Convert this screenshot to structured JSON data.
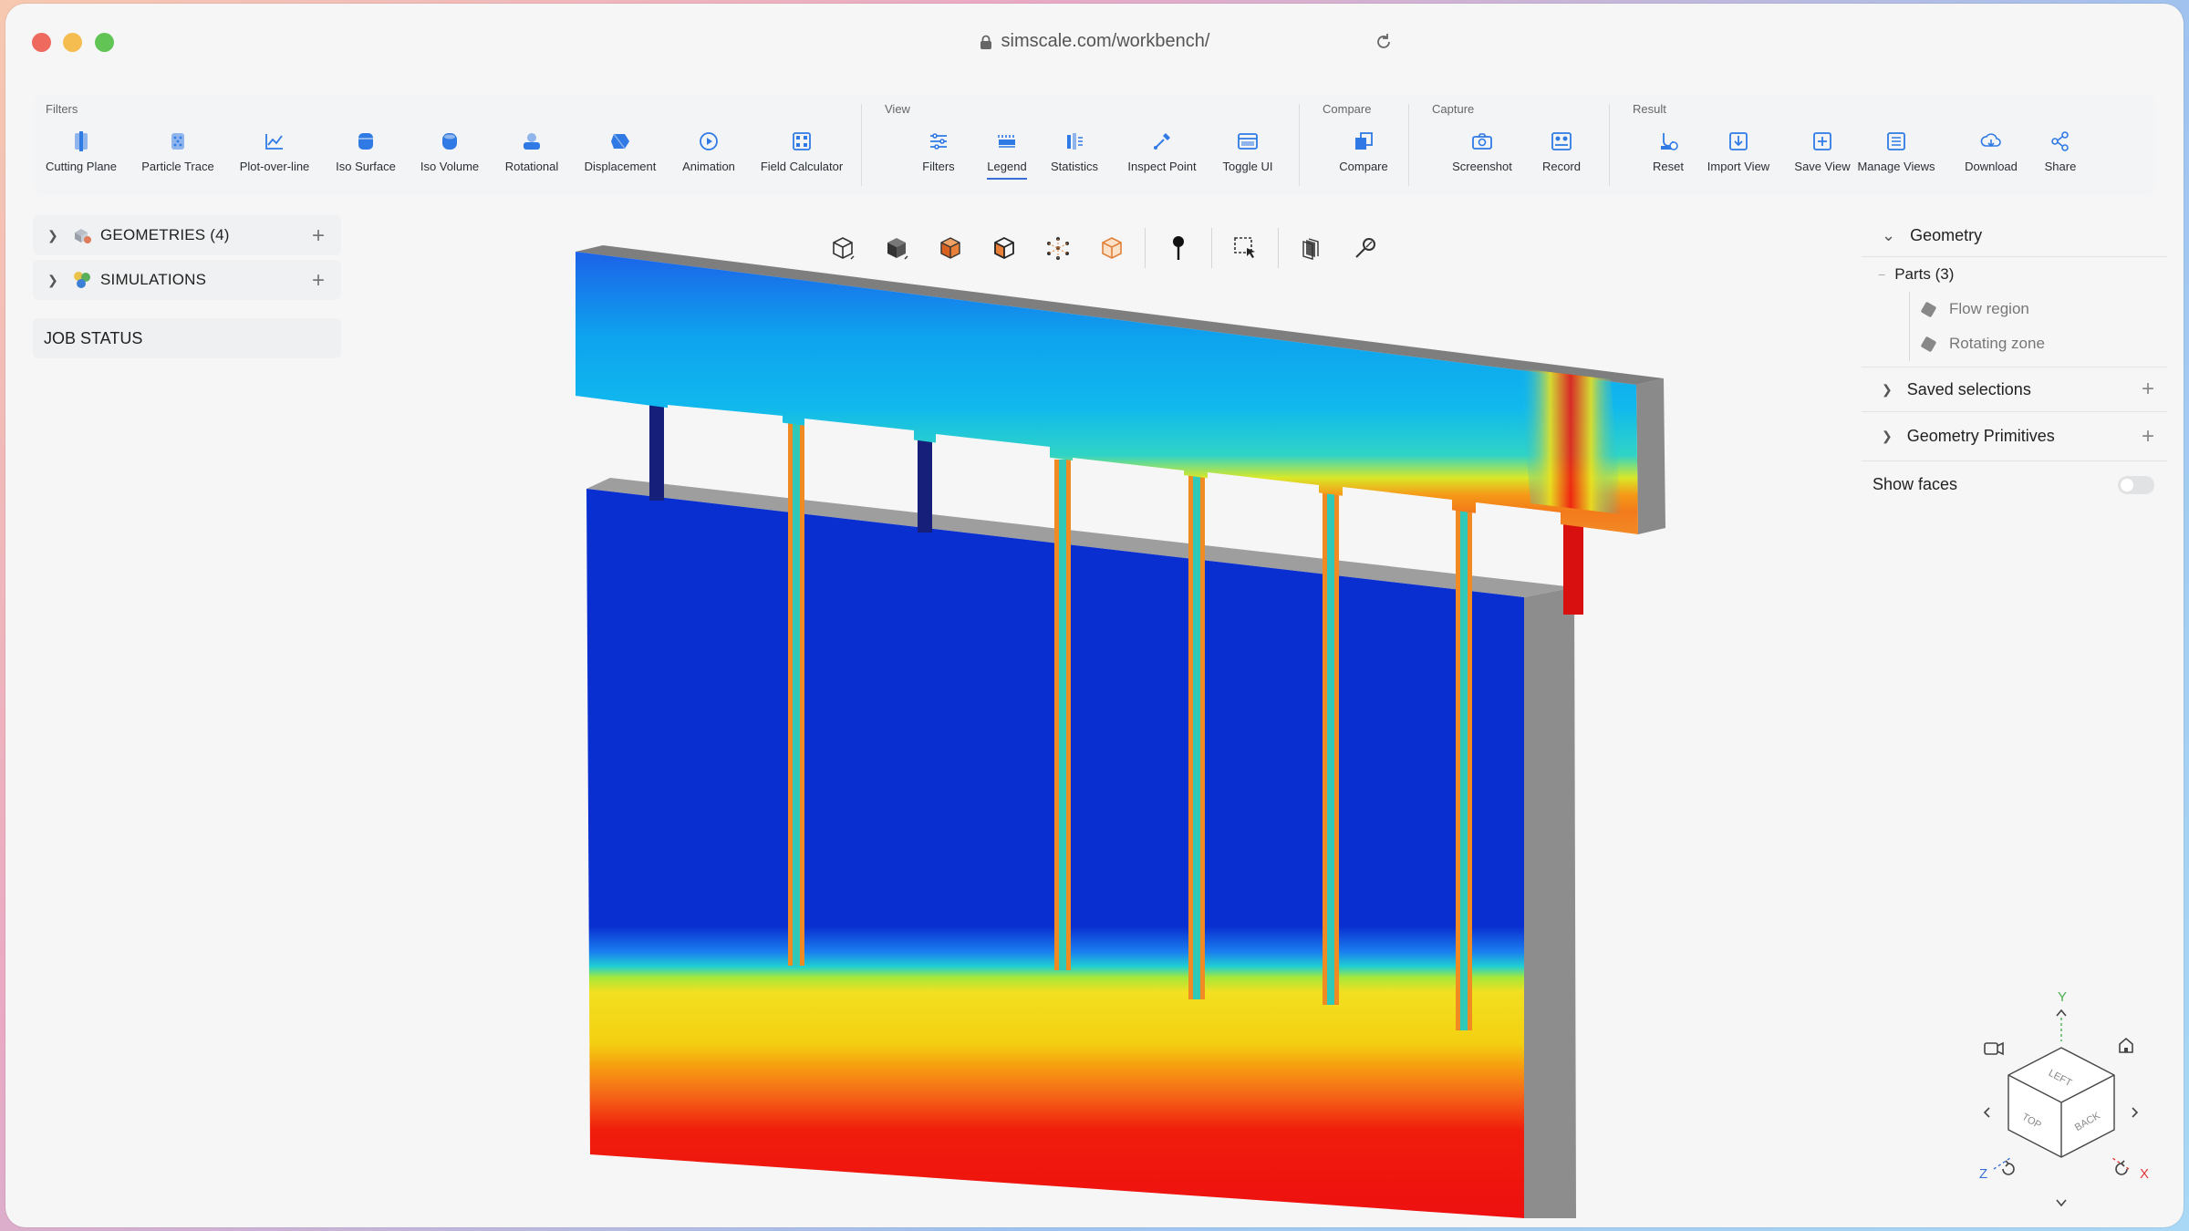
{
  "browser": {
    "url": "simscale.com/workbench/"
  },
  "toolbar": {
    "groups": [
      {
        "label": "Filters",
        "tools": [
          "Cutting Plane",
          "Particle Trace",
          "Plot-over-line",
          "Iso Surface",
          "Iso Volume",
          "Rotational",
          "Displacement",
          "Animation",
          "Field Calculator"
        ]
      },
      {
        "label": "View",
        "tools": [
          "Filters",
          "Legend",
          "Statistics",
          "Inspect Point",
          "Toggle UI"
        ],
        "active": "Legend"
      },
      {
        "label": "Compare",
        "tools": [
          "Compare"
        ]
      },
      {
        "label": "Capture",
        "tools": [
          "Screenshot",
          "Record"
        ]
      },
      {
        "label": "Result",
        "tools": [
          "Reset",
          "Import View",
          "Save View",
          "Manage Views",
          "Download",
          "Share"
        ]
      }
    ]
  },
  "left_panel": {
    "geometries": "GEOMETRIES (4)",
    "simulations": "SIMULATIONS",
    "job_status": "JOB STATUS"
  },
  "right_panel": {
    "geometry": "Geometry",
    "parts": "Parts (3)",
    "part_items": [
      "Flow region",
      "Rotating zone"
    ],
    "saved_selections": "Saved selections",
    "geometry_primitives": "Geometry Primitives",
    "show_faces": "Show faces",
    "show_faces_on": false
  },
  "nav_cube": {
    "faces": [
      "LEFT",
      "TOP",
      "BACK"
    ],
    "axes": [
      "Y",
      "Z",
      "X"
    ]
  },
  "colors": {
    "accent": "#3a6fd8",
    "icon_blue": "#2f7ae5"
  }
}
